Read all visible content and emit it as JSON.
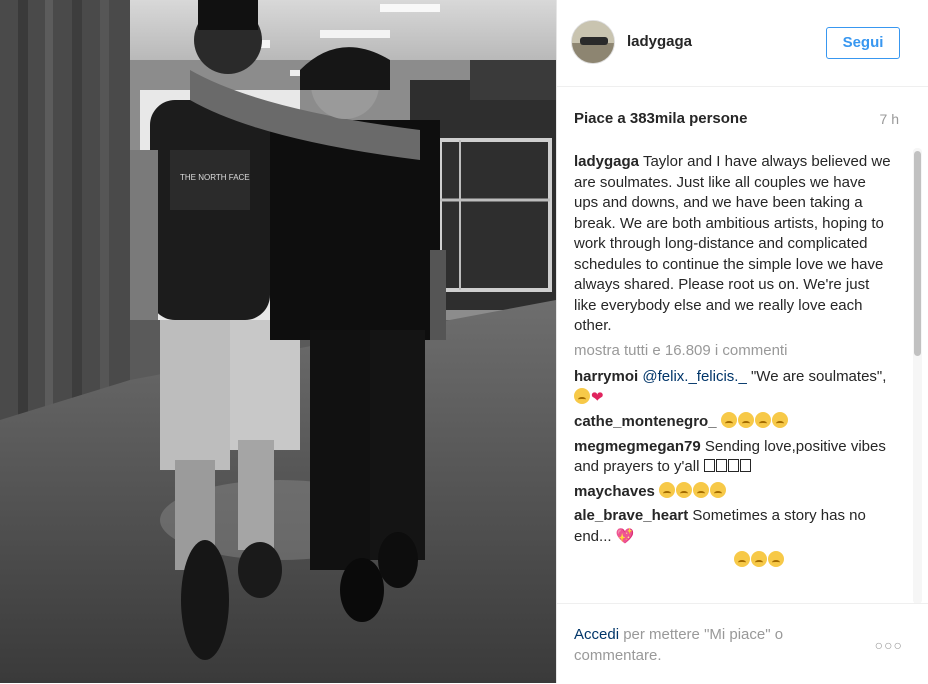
{
  "post": {
    "username": "ladygaga",
    "follow_label": "Segui",
    "likes": "Piace a 383mila persone",
    "time": "7 h"
  },
  "caption": {
    "user": "ladygaga",
    "text": "Taylor and I have always believed we are soulmates. Just like all couples we have ups and downs, and we have been taking a break. We are both ambitious artists, hoping to work through long-distance and complicated schedules to continue the simple love we have always shared. Please root us on. We're just like everybody else and we really love each other."
  },
  "more_comments": "mostra tutti e 16.809 i commenti",
  "comments": [
    {
      "user": "harrymoi",
      "mention": "@felix._felicis._",
      "text": " \"We are soulmates\","
    },
    {
      "user": "cathe_montenegro_",
      "text": ""
    },
    {
      "user": "megmegmegan79",
      "text": "Sending love,positive vibes and prayers to y'all"
    },
    {
      "user": "maychaves",
      "text": ""
    },
    {
      "user": "ale_brave_heart",
      "text": "Sometimes a story has no end..."
    }
  ],
  "footer": {
    "login_link": "Accedi",
    "login_text": " per mettere \"Mi piace\" o commentare.",
    "more_icon": "ellipsis-icon"
  },
  "colors": {
    "accent": "#3897f0",
    "link": "#003569",
    "muted": "#999999"
  }
}
